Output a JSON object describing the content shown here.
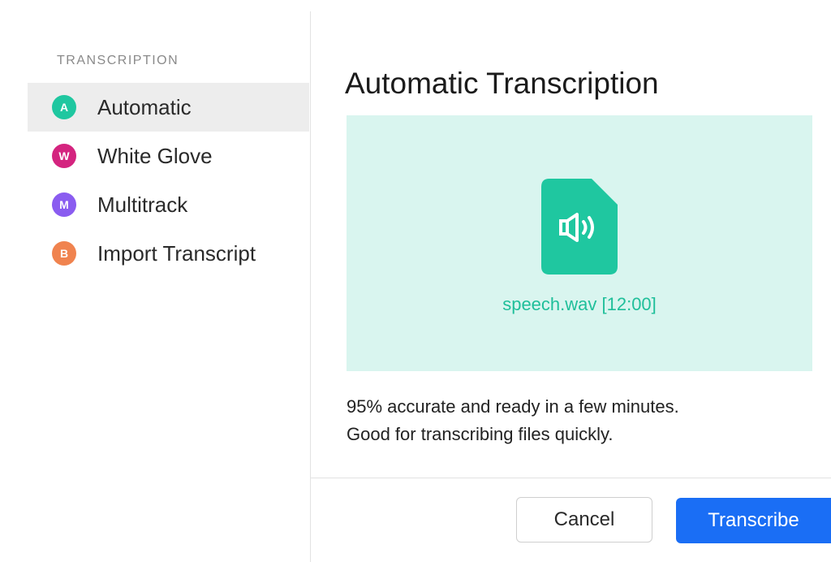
{
  "sidebar": {
    "section_title": "TRANSCRIPTION",
    "items": [
      {
        "badge": "A",
        "label": "Automatic",
        "color": "#1fc7a0",
        "selected": true
      },
      {
        "badge": "W",
        "label": "White Glove",
        "color": "#d4247f",
        "selected": false
      },
      {
        "badge": "M",
        "label": "Multitrack",
        "color": "#8a5cf0",
        "selected": false
      },
      {
        "badge": "B",
        "label": "Import Transcript",
        "color": "#f0834f",
        "selected": false
      }
    ]
  },
  "main": {
    "title": "Automatic Transcription",
    "preview": {
      "icon": "audio-file-icon",
      "file_label": "speech.wav [12:00]",
      "bg_color": "#d9f5ef",
      "accent_color": "#1fc7a0"
    },
    "description": [
      "95% accurate and ready in a few minutes.",
      "Good for transcribing files quickly."
    ]
  },
  "footer": {
    "cancel_label": "Cancel",
    "primary_label": "Transcribe",
    "primary_color": "#1a6ef5"
  }
}
